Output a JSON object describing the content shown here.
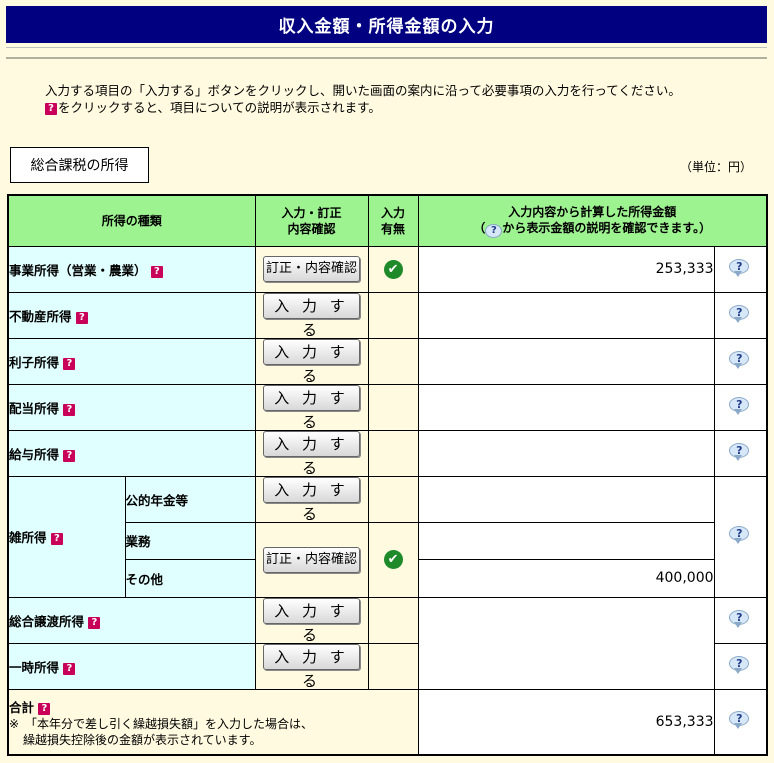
{
  "header": {
    "title": "収入金額・所得金額の入力"
  },
  "instructions": {
    "line1": "入力する項目の「入力する」ボタンをクリックし、開いた画面の案内に沿って必要事項の入力を行ってください。",
    "line2": "をクリックすると、項目についての説明が表示されます。"
  },
  "section": {
    "label": "総合課税の所得",
    "unit": "（単位：円）"
  },
  "table": {
    "headers": {
      "kind": "所得の種類",
      "input_l1": "入力・訂正",
      "input_l2": "内容確認",
      "status_l1": "入力",
      "status_l2": "有無",
      "amount_l1": "入力内容から計算した所得金額",
      "amount_l2_pre": "（",
      "amount_l2_post": "から表示金額の説明を確認できます。）"
    },
    "rows": [
      {
        "label": "事業所得（営業・農業）",
        "button": "訂正・内容確認",
        "done": true,
        "amount": "253,333"
      },
      {
        "label": "不動産所得",
        "button": "入 力 す る",
        "done": false,
        "amount": ""
      },
      {
        "label": "利子所得",
        "button": "入 力 す る",
        "done": false,
        "amount": ""
      },
      {
        "label": "配当所得",
        "button": "入 力 す る",
        "done": false,
        "amount": ""
      },
      {
        "label": "給与所得",
        "button": "入 力 す る",
        "done": false,
        "amount": ""
      }
    ],
    "misc": {
      "label": "雑所得",
      "sub": [
        {
          "label": "公的年金等",
          "button": "入 力 す る"
        },
        {
          "label": "業務",
          "button": "訂正・内容確認"
        },
        {
          "label": "その他",
          "amount": "400,000"
        }
      ]
    },
    "rows2": [
      {
        "label": "総合譲渡所得",
        "button": "入 力 す る"
      },
      {
        "label": "一時所得",
        "button": "入 力 す る"
      }
    ],
    "total": {
      "label": "合計",
      "note1": "※　「本年分で差し引く繰越損失額」を入力した場合は、",
      "note2": "繰越損失控除後の金額が表示されています。",
      "amount": "653,333"
    }
  },
  "icons": {
    "question": "?",
    "check": "✔",
    "help_bubble": "?"
  },
  "colors": {
    "title_bg": "#000080",
    "header_bg": "#9ef391",
    "kind_bg": "#e0ffff",
    "page_bg": "#fffae0"
  }
}
